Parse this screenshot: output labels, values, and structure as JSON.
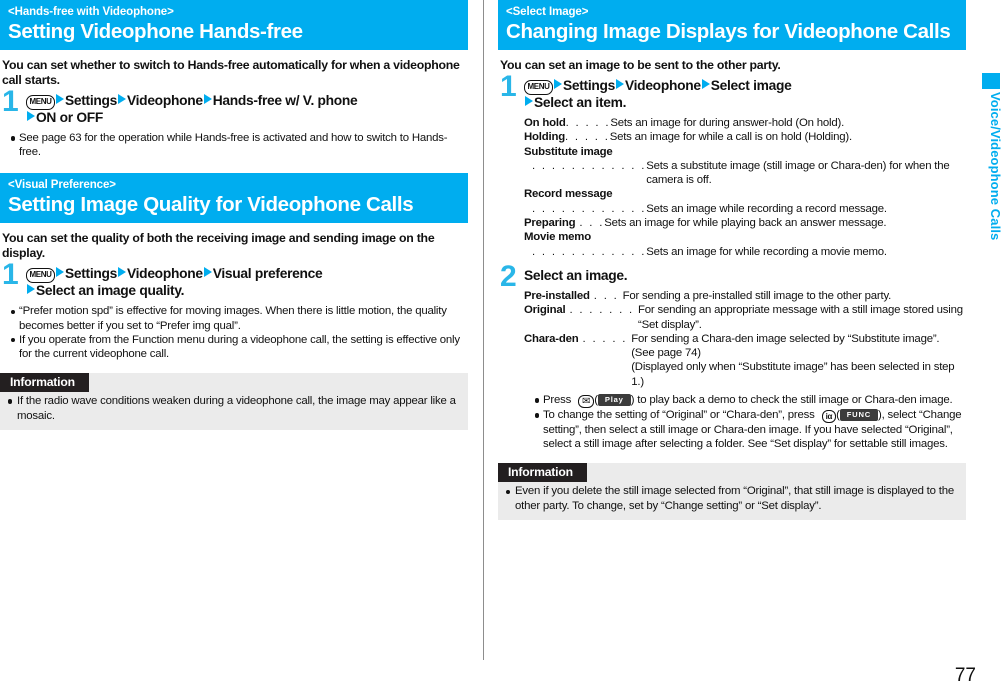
{
  "page": {
    "folio": "77",
    "side_tab_label": "Voice/Videophone Calls",
    "accent_color": "#00adef",
    "info_title_bg": "#231f20",
    "info_box_bg": "#ebebeb"
  },
  "left_column": {
    "sections": [
      {
        "kicker": "<Hands-free with Videophone>",
        "title": "Setting Videophone Hands-free",
        "intro": "You can set whether to switch to Hands-free automatically for when a videophone call starts.",
        "step": {
          "number": "1",
          "key_label": "MENU",
          "path_1": "Settings",
          "path_2": "Videophone",
          "path_3": "Hands-free w/ V. phone",
          "path_4": "ON or OFF"
        },
        "notes": [
          "See page 63 for the operation while Hands-free is activated and how to switch to Hands-free."
        ]
      },
      {
        "kicker": "<Visual Preference>",
        "title": "Setting Image Quality for Videophone Calls",
        "intro": "You can set the quality of both the receiving image and sending image on the display.",
        "step": {
          "number": "1",
          "key_label": "MENU",
          "path_1": "Settings",
          "path_2": "Videophone",
          "path_3": "Visual preference",
          "path_4": "Select an image quality."
        },
        "notes": [
          "“Prefer motion spd” is effective for moving images. When there is little motion, the quality becomes better if you set to “Prefer img qual”.",
          "If you operate from the Function menu during a videophone call, the setting is effective only for the current videophone call."
        ],
        "information": {
          "title": "Information",
          "items": [
            "If the radio wave conditions weaken during a videophone call, the image may appear like a mosaic."
          ]
        }
      }
    ]
  },
  "right_column": {
    "section": {
      "kicker": "<Select Image>",
      "title": "Changing Image Displays for Videophone Calls",
      "intro": "You can set an image to be sent to the other party.",
      "step1": {
        "number": "1",
        "key_label": "MENU",
        "path_1": "Settings",
        "path_2": "Videophone",
        "path_3": "Select image",
        "path_4": "Select an item."
      },
      "step1_items": [
        {
          "term": "On hold",
          "dots": ". . . . .",
          "desc": "Sets an image for during answer-hold (On hold)."
        },
        {
          "term": "Holding",
          "dots": ". . . . .",
          "desc": "Sets an image for while a call is on hold (Holding)."
        },
        {
          "term": "Substitute image",
          "dots": ". . . . . . . . . . . .",
          "desc": "Sets a substitute image (still image or Chara-den) for when the camera is off.",
          "block": true
        },
        {
          "term": "Record message",
          "dots": ". . . . . . . . . . . .",
          "desc": "Sets an image while recording a record message.",
          "block": true
        },
        {
          "term": "Preparing",
          "dots": ". . .",
          "desc": "Sets an image for while playing back an answer message."
        },
        {
          "term": "Movie memo",
          "dots": ". . . . . . . . . . . .",
          "desc": "Sets an image for while recording a movie memo.",
          "block": true
        }
      ],
      "step2": {
        "number": "2",
        "heading": "Select an image."
      },
      "step2_items": [
        {
          "term": "Pre-installed",
          "dots": ". . .",
          "desc": "For sending a pre-installed still image to the other party.",
          "extra": []
        },
        {
          "term": "Original",
          "dots": ". . . . . . .",
          "desc": "For sending an appropriate message with a still image stored using “Set display”.",
          "extra": []
        },
        {
          "term": "Chara-den",
          "dots": ". . . . .",
          "desc": "For sending a Chara-den image selected by “Substitute image”.",
          "extra": [
            "(See page 74)",
            "(Displayed only when “Substitute image” has been selected in step 1.)"
          ]
        }
      ],
      "step2_notes": {
        "note1_pre": "Press",
        "note1_key": "✉",
        "note1_softkey": "Play",
        "note1_post": ") to play back a demo to check the still image or Chara-den image.",
        "note2_pre": "To change the setting of “Original” or “Chara-den”, press",
        "note2_key": "iα",
        "note2_softkey": "FUNC",
        "note2_post": "), select “Change setting”, then select a still image or Chara-den image. If you have selected “Original”, select a still image after selecting a folder. See “Set display” for settable still images."
      },
      "information": {
        "title": "Information",
        "items": [
          "Even if you delete the still image selected from “Original”, that still image is displayed to the other party. To change, set by “Change setting” or “Set display”."
        ]
      }
    }
  }
}
